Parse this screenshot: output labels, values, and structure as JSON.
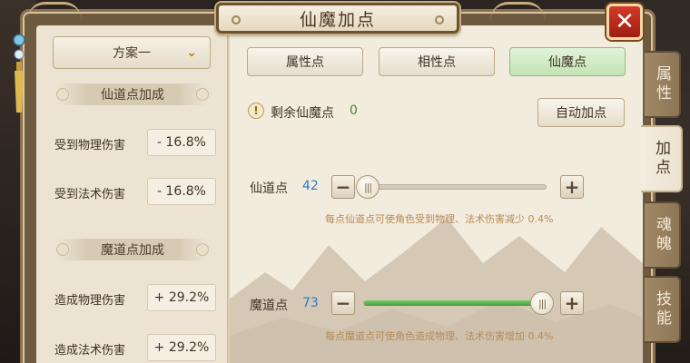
{
  "window": {
    "title": "仙魔加点",
    "close_symbol": "✕"
  },
  "scheme": {
    "selected": "方案一",
    "chevron": "chevron-down-icon"
  },
  "left": {
    "xian_section": "仙道点加成",
    "xian_stats": [
      {
        "label": "受到物理伤害",
        "value": "- 16.8%"
      },
      {
        "label": "受到法术伤害",
        "value": "- 16.8%"
      }
    ],
    "mo_section": "魔道点加成",
    "mo_stats": [
      {
        "label": "造成物理伤害",
        "value": "+ 29.2%"
      },
      {
        "label": "造成法术伤害",
        "value": "+ 29.2%"
      }
    ]
  },
  "tabs": [
    {
      "label": "属性点"
    },
    {
      "label": "相性点"
    },
    {
      "label": "仙魔点",
      "active": true
    }
  ],
  "remaining": {
    "icon": "warning-icon",
    "icon_glyph": "!",
    "label": "剩余仙魔点",
    "value": "0"
  },
  "auto_button": "自动加点",
  "attributes": [
    {
      "label": "仙道点",
      "value": "42",
      "fill": 0.0,
      "hint": "每点仙道点可使角色受到物理、法术伤害减少 0.4%"
    },
    {
      "label": "魔道点",
      "value": "73",
      "fill": 1.0,
      "hint": "每点魔道点可使角色造成物理、法术伤害增加 0.4%"
    }
  ],
  "stepper": {
    "minus": "−",
    "plus": "+"
  },
  "side_tabs": [
    {
      "label": "属性"
    },
    {
      "label": "加点",
      "active": true
    },
    {
      "label": "魂魄"
    },
    {
      "label": "技能"
    }
  ],
  "colors": {
    "accent_green": "#3a8a2e",
    "value_blue": "#3276c6",
    "close_red": "#c52f21"
  }
}
